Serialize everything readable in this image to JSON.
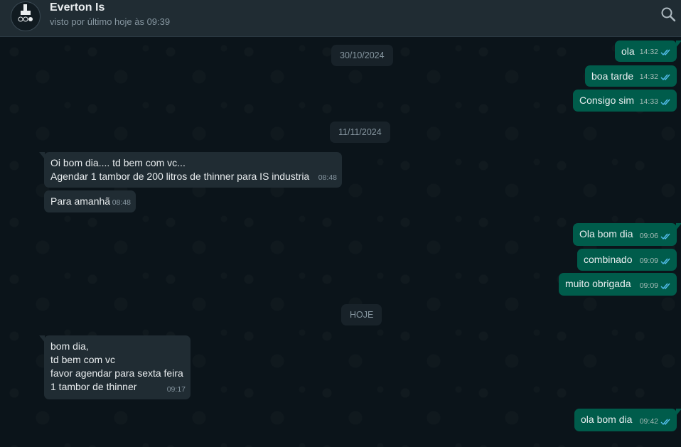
{
  "contact": {
    "name": "Everton Is",
    "status": "visto por último hoje às 09:39"
  },
  "icons": {
    "search": "search-icon",
    "read_receipt": "double-check-icon"
  },
  "colors": {
    "outgoing_bubble": "#005c4b",
    "incoming_bubble": "#202c33",
    "read_tick": "#53bdeb",
    "background": "#0b141a"
  },
  "chat": {
    "dates": [
      "30/10/2024",
      "11/11/2024",
      "HOJE"
    ],
    "messages": [
      {
        "dir": "out",
        "text": "ola",
        "time": "14:32"
      },
      {
        "dir": "out",
        "text": "boa tarde",
        "time": "14:32"
      },
      {
        "dir": "out",
        "text": "Consigo sim",
        "time": "14:33"
      },
      {
        "dir": "in",
        "text": "Oi bom dia.... td bem com vc...\nAgendar 1 tambor de 200 litros de thinner para IS industria",
        "time": "08:48"
      },
      {
        "dir": "in",
        "text": "Para amanhã",
        "time": "08:48"
      },
      {
        "dir": "out",
        "text": "Ola bom dia",
        "time": "09:06"
      },
      {
        "dir": "out",
        "text": "combinado",
        "time": "09:09"
      },
      {
        "dir": "out",
        "text": "muito obrigada",
        "time": "09:09"
      },
      {
        "dir": "in",
        "text": "bom dia,\ntd bem com vc\nfavor agendar para sexta feira\n1 tambor de thinner",
        "time": "09:17"
      },
      {
        "dir": "out",
        "text": "ola bom dia",
        "time": "09:42"
      }
    ]
  }
}
